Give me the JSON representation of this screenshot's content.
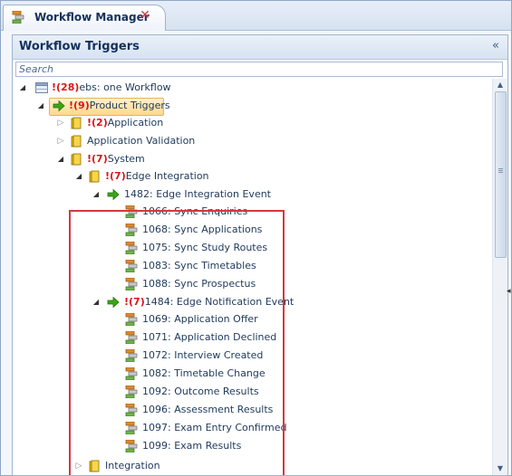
{
  "tab": {
    "title": "Workflow Manager",
    "close_glyph": "✕"
  },
  "panel": {
    "title": "Workflow Triggers",
    "collapse_glyph": "«"
  },
  "search": {
    "placeholder": "Search"
  },
  "scrollbar": {
    "up_glyph": "▲",
    "down_glyph": "▼"
  },
  "colors": {
    "count_red": "#d9161b",
    "highlight_border": "#d9373c",
    "selected_bg": "#ffd98a",
    "arrow_green": "#3aa617",
    "folder_yellow": "#e6b800"
  },
  "tree": {
    "root": {
      "count": "!(28)",
      "label": "ebs: one Workflow",
      "icon": "table-icon"
    },
    "product_triggers": {
      "count": "!(9)",
      "label": "Product Triggers",
      "icon": "green-arrow-icon",
      "selected": true
    },
    "application": {
      "count": "!(2)",
      "label": "Application",
      "icon": "folder-icon"
    },
    "application_validation": {
      "label": "Application Validation",
      "icon": "folder-icon"
    },
    "system": {
      "count": "!(7)",
      "label": "System",
      "icon": "folder-icon"
    },
    "edge_integration": {
      "count": "!(7)",
      "label": "Edge Integration",
      "icon": "folder-icon"
    },
    "event_1482": {
      "label": "1482: Edge Integration Event",
      "icon": "green-arrow-icon"
    },
    "wf_1066": {
      "label": "1066: Sync Enquiries",
      "icon": "workflow-icon"
    },
    "wf_1068": {
      "label": "1068: Sync Applications",
      "icon": "workflow-icon"
    },
    "wf_1075": {
      "label": "1075: Sync Study Routes",
      "icon": "workflow-icon"
    },
    "wf_1083": {
      "label": "1083: Sync Timetables",
      "icon": "workflow-icon"
    },
    "wf_1088": {
      "label": "1088: Sync Prospectus",
      "icon": "workflow-icon"
    },
    "event_1484": {
      "count": "!(7)",
      "label": "1484: Edge Notification Event",
      "icon": "green-arrow-icon"
    },
    "wf_1069": {
      "label": "1069: Application Offer",
      "icon": "workflow-icon"
    },
    "wf_1071": {
      "label": "1071: Application Declined",
      "icon": "workflow-icon"
    },
    "wf_1072": {
      "label": "1072: Interview Created",
      "icon": "workflow-icon"
    },
    "wf_1082": {
      "label": "1082: Timetable Change",
      "icon": "workflow-icon"
    },
    "wf_1092": {
      "label": "1092: Outcome Results",
      "icon": "workflow-icon"
    },
    "wf_1096": {
      "label": "1096: Assessment Results",
      "icon": "workflow-icon"
    },
    "wf_1097": {
      "label": "1097: Exam Entry Confirmed",
      "icon": "workflow-icon"
    },
    "wf_1099": {
      "label": "1099: Exam Results",
      "icon": "workflow-icon"
    },
    "integration": {
      "label": "Integration",
      "icon": "folder-icon"
    }
  }
}
